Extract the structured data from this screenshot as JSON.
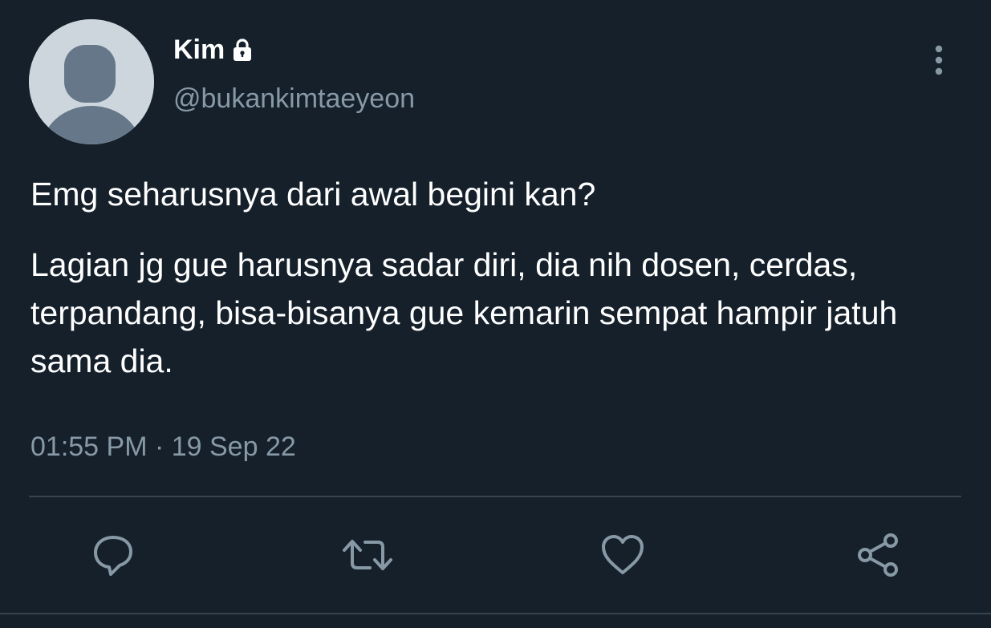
{
  "tweet": {
    "display_name": "Kim",
    "handle": "@bukankimtaeyeon",
    "text": [
      "Emg seharusnya dari awal begini kan?",
      "Lagian jg gue harusnya sadar diri, dia nih dosen, cerdas, terpandang, bisa-bisanya gue kemarin sempat hampir jatuh sama dia."
    ],
    "timestamp": "01:55 PM · 19 Sep 22",
    "protected_icon": "lock-icon",
    "more_icon": "more-vertical-icon"
  },
  "actions": [
    {
      "name": "reply",
      "icon": "reply-icon"
    },
    {
      "name": "retweet",
      "icon": "retweet-icon"
    },
    {
      "name": "like",
      "icon": "heart-icon"
    },
    {
      "name": "share",
      "icon": "share-icon"
    }
  ],
  "colors": {
    "background": "#15202b",
    "primary_text": "#ffffff",
    "secondary_text": "#8899a6",
    "divider": "#38444d",
    "avatar_bg": "#cdd6dd",
    "avatar_figure": "#66778a"
  }
}
